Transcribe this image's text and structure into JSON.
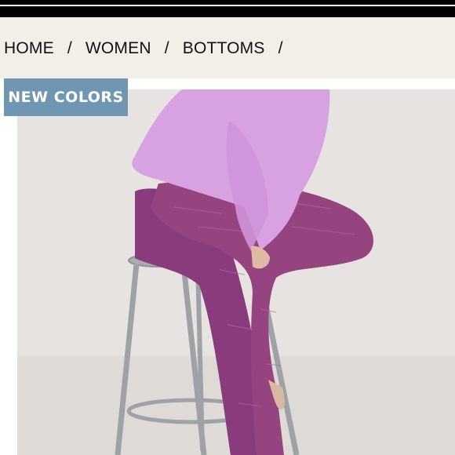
{
  "breadcrumb": {
    "items": [
      "HOME",
      "WOMEN",
      "BOTTOMS"
    ],
    "separator": "/"
  },
  "badge": {
    "label": "NEW COLORS"
  },
  "colors": {
    "badge_bg": "#6f97b2",
    "crumb_bg": "#f2efe9",
    "topbar": "#000000",
    "top_color": "#d79fe2",
    "legging_color": "#8b3b7e"
  }
}
